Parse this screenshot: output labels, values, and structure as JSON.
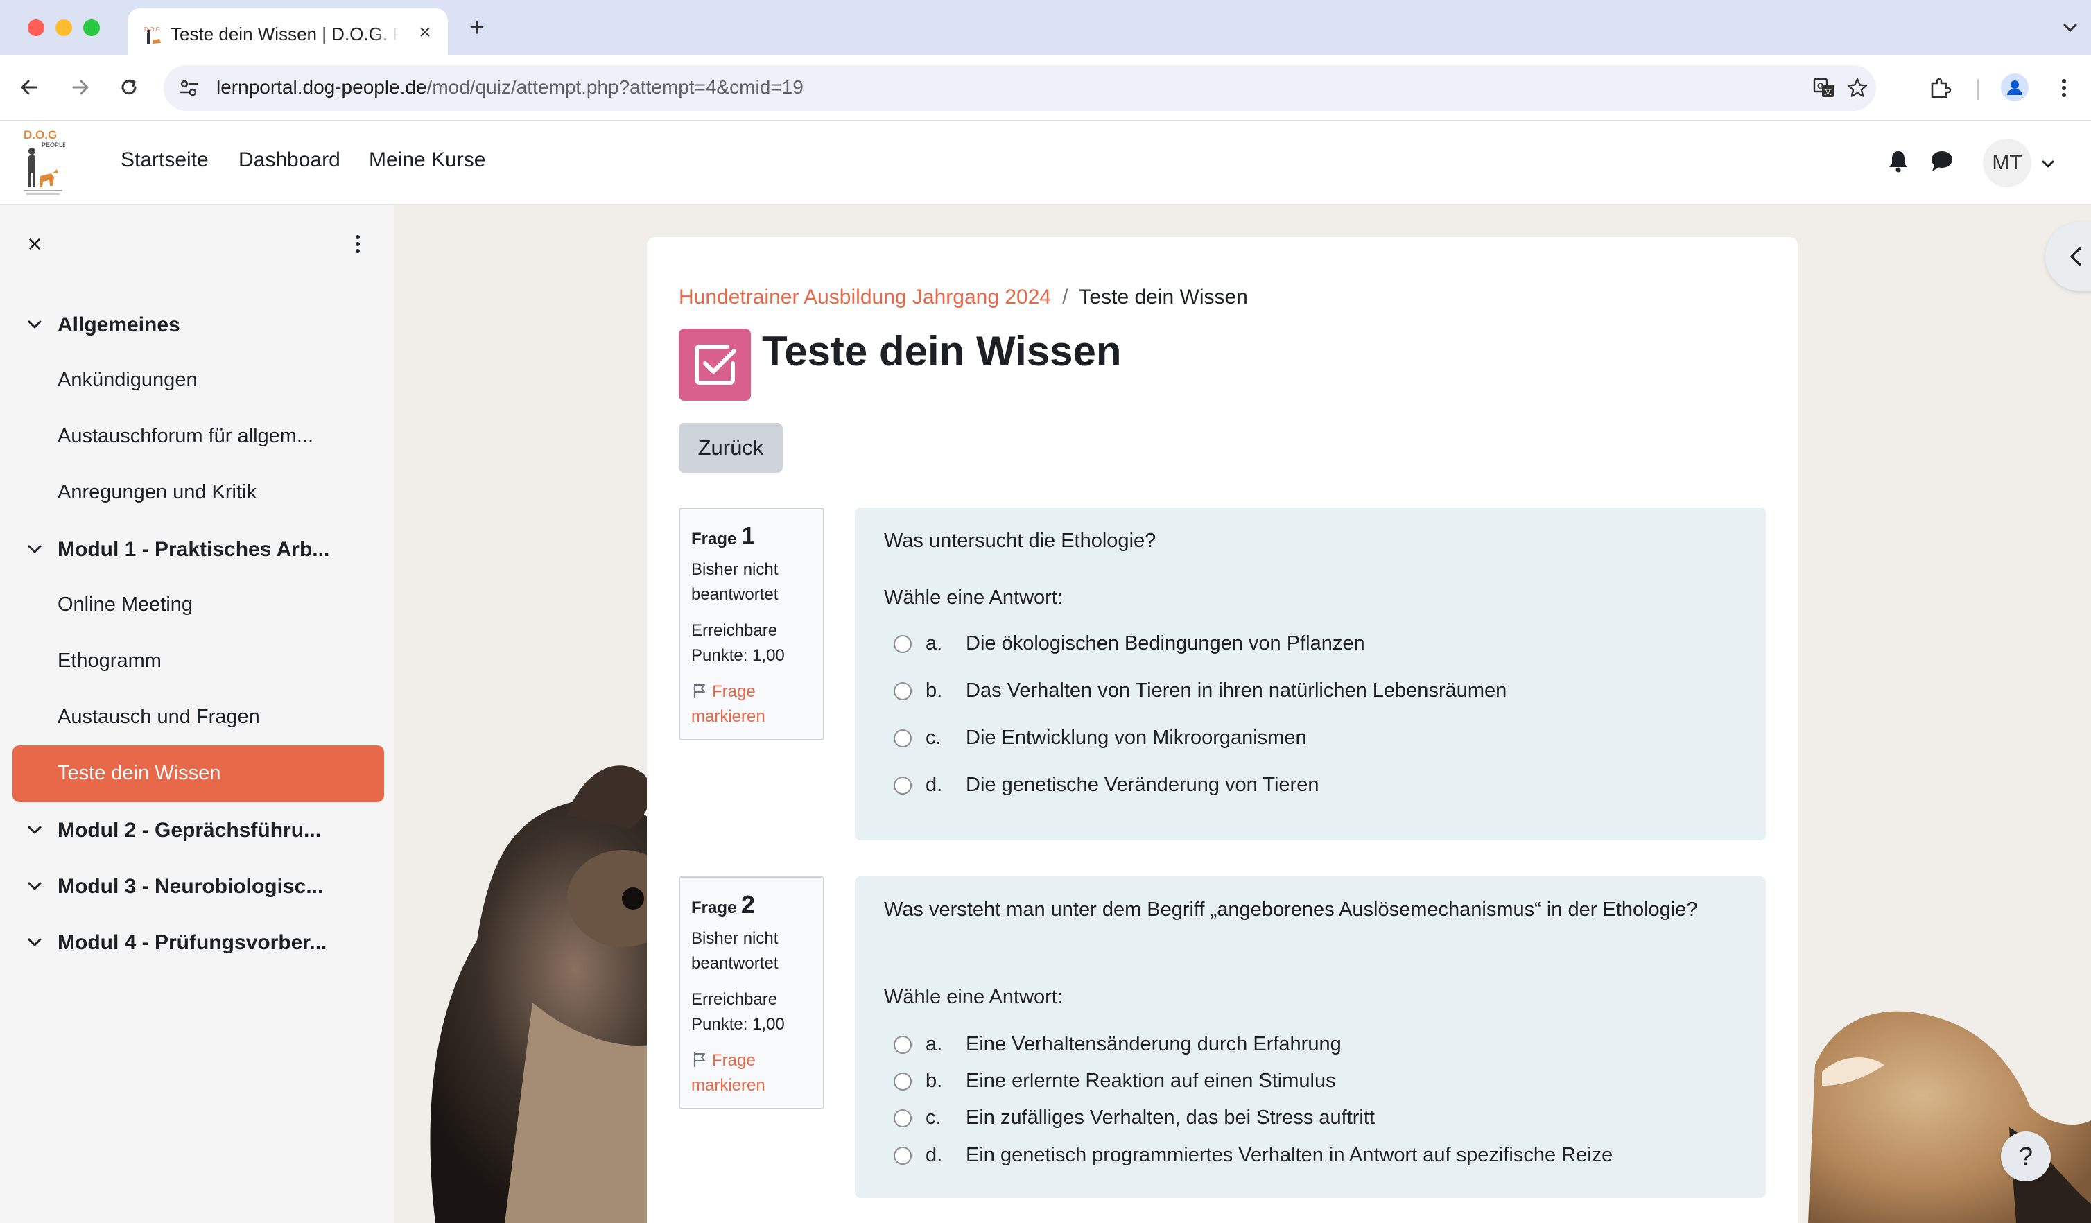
{
  "browser": {
    "tab_title": "Teste dein Wissen | D.O.G. People",
    "url_host": "lernportal.dog-people.de",
    "url_path": "/mod/quiz/attempt.php?attempt=4&cmid=19"
  },
  "navbar": {
    "links": [
      "Startseite",
      "Dashboard",
      "Meine Kurse"
    ],
    "user_initials": "MT",
    "logo_text": "D.O.G PEOPLE"
  },
  "drawer": {
    "sections": [
      {
        "label": "Allgemeines",
        "items": [
          "Ankündigungen",
          "Austauschforum für allgem...",
          "Anregungen und Kritik"
        ]
      },
      {
        "label": "Modul 1 - Praktisches Arb...",
        "items": [
          "Online Meeting",
          "Ethogramm",
          "Austausch und Fragen",
          "Teste dein Wissen"
        ]
      },
      {
        "label": "Modul 2 - Geprächsführu...",
        "items": []
      },
      {
        "label": "Modul 3 - Neurobiologisc...",
        "items": []
      },
      {
        "label": "Modul 4 - Prüfungsvorber...",
        "items": []
      }
    ],
    "active_item": "Teste dein Wissen"
  },
  "page": {
    "breadcrumb_course": "Hundetrainer Ausbildung Jahrgang 2024",
    "breadcrumb_separator": "/",
    "breadcrumb_current": "Teste dein Wissen",
    "title": "Teste dein Wissen",
    "back_button": "Zurück"
  },
  "questions": [
    {
      "label": "Frage",
      "number": "1",
      "state": "Bisher nicht beantwortet",
      "grade": "Erreichbare Punkte: 1,00",
      "flag": "Frage markieren",
      "text": "Was untersucht die Ethologie?",
      "prompt": "Wähle eine Antwort:",
      "answers": [
        {
          "letter": "a.",
          "text": "Die ökologischen Bedingungen von Pflanzen"
        },
        {
          "letter": "b.",
          "text": "Das Verhalten von Tieren in ihren natürlichen Lebensräumen"
        },
        {
          "letter": "c.",
          "text": "Die Entwicklung von Mikroorganismen"
        },
        {
          "letter": "d.",
          "text": "Die genetische Veränderung von Tieren"
        }
      ]
    },
    {
      "label": "Frage",
      "number": "2",
      "state": "Bisher nicht beantwortet",
      "grade": "Erreichbare Punkte: 1,00",
      "flag": "Frage markieren",
      "text": "Was versteht man unter dem Begriff „angeborenes Auslösemechanismus“ in der Ethologie?",
      "prompt": "Wähle eine Antwort:",
      "answers": [
        {
          "letter": "a.",
          "text": "Eine Verhaltensänderung durch Erfahrung"
        },
        {
          "letter": "b.",
          "text": "Eine erlernte Reaktion auf einen Stimulus"
        },
        {
          "letter": "c.",
          "text": "Ein zufälliges Verhalten, das bei Stress auftritt"
        },
        {
          "letter": "d.",
          "text": "Ein genetisch programmiertes Verhalten in Antwort auf spezifische Reize"
        }
      ]
    }
  ],
  "help_label": "?",
  "colors": {
    "accent": "#e8694a",
    "quiz_icon": "#d95f8c",
    "question_bg": "#e7f0f3"
  }
}
